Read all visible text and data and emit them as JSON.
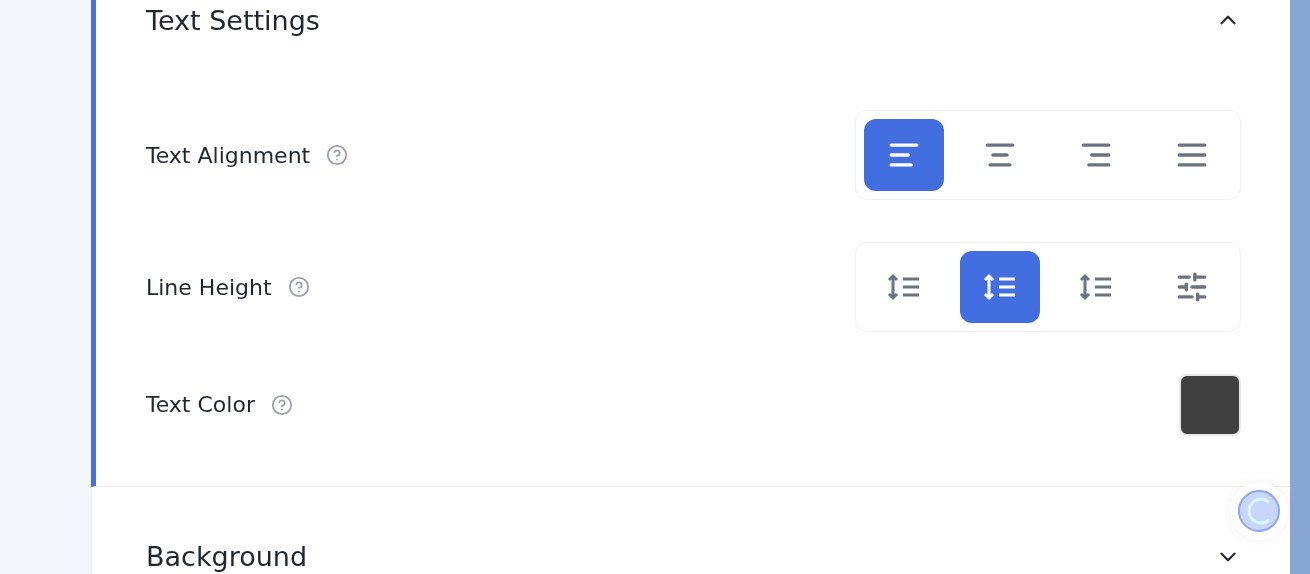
{
  "sections": [
    {
      "title": "Text Settings",
      "expanded": true,
      "settings": [
        {
          "kind": "segmented",
          "label": "Text Alignment",
          "options": [
            {
              "kind": "align-left",
              "selected": true
            },
            {
              "kind": "align-center",
              "selected": false
            },
            {
              "kind": "align-right",
              "selected": false
            },
            {
              "kind": "align-justify",
              "selected": false
            }
          ]
        },
        {
          "kind": "segmented",
          "label": "Line Height",
          "options": [
            {
              "kind": "line-height",
              "selected": false
            },
            {
              "kind": "line-height",
              "selected": true
            },
            {
              "kind": "line-height",
              "selected": false
            },
            {
              "kind": "custom",
              "selected": false
            }
          ]
        },
        {
          "kind": "color",
          "label": "Text Color",
          "color": "#404040"
        }
      ]
    },
    {
      "title": "Background",
      "expanded": false
    }
  ]
}
